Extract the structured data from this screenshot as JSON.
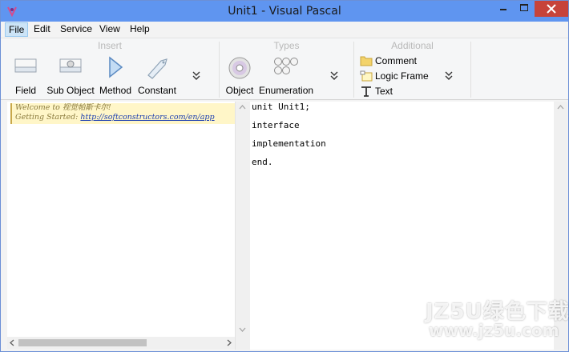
{
  "window": {
    "title": "Unit1 - Visual Pascal"
  },
  "menu": [
    {
      "label": "File",
      "active": true
    },
    {
      "label": "Edit"
    },
    {
      "label": "Service"
    },
    {
      "label": "View"
    },
    {
      "label": "Help"
    }
  ],
  "ribbon": {
    "insert": {
      "caption": "Insert",
      "buttons": [
        {
          "label": "Field",
          "icon": "field-icon"
        },
        {
          "label": "Sub Object",
          "icon": "sub-object-icon"
        },
        {
          "label": "Method",
          "icon": "method-icon"
        },
        {
          "label": "Constant",
          "icon": "constant-icon"
        }
      ]
    },
    "types": {
      "caption": "Types",
      "buttons": [
        {
          "label": "Object",
          "icon": "object-icon"
        },
        {
          "label": "Enumeration",
          "icon": "enumeration-icon"
        }
      ]
    },
    "additional": {
      "caption": "Additional",
      "buttons": [
        {
          "label": "Comment",
          "icon": "folder-icon"
        },
        {
          "label": "Logic Frame",
          "icon": "logic-frame-icon"
        },
        {
          "label": "Text",
          "icon": "text-icon"
        }
      ]
    }
  },
  "welcome": {
    "line1": "Welcome to 视觉帕斯卡尔!",
    "line2_prefix": "Getting Started: ",
    "line2_link": "http://softconstructors.com/en/app"
  },
  "editor": {
    "lines": [
      "unit Unit1;",
      "interface",
      "implementation",
      "end."
    ]
  },
  "watermark": {
    "line1": "JZ5U绿色下载",
    "line2": "www.jz5u.com"
  },
  "colors": {
    "titlebar": "#5f95f0",
    "close_button": "#c7433a",
    "menu_active": "#cce4f7",
    "welcome_bg": "#fff6c8",
    "link": "#1d3fb0"
  }
}
